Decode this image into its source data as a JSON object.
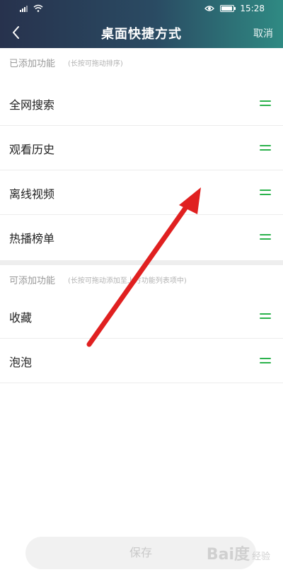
{
  "status_bar": {
    "time": "15:28",
    "signal_icon": "signal-icon",
    "wifi_icon": "wifi-icon",
    "eye_icon": "eye-comfort-icon",
    "battery_icon": "battery-icon"
  },
  "nav": {
    "back_icon": "back-chevron-icon",
    "title": "桌面快捷方式",
    "cancel": "取消"
  },
  "added": {
    "title": "已添加功能",
    "hint": "(长按可拖动排序)",
    "items": [
      {
        "label": "全网搜索"
      },
      {
        "label": "观看历史"
      },
      {
        "label": "离线视频"
      },
      {
        "label": "热播榜单"
      }
    ]
  },
  "available": {
    "title": "可添加功能",
    "hint": "(长按可拖动添加至上方功能列表项中)",
    "items": [
      {
        "label": "收藏"
      },
      {
        "label": "泡泡"
      }
    ]
  },
  "save_button": "保存",
  "watermark": {
    "brand": "Bai度",
    "sub": "经验"
  },
  "colors": {
    "header_start": "#27324d",
    "header_end": "#2f8a83",
    "drag_handle": "#2bb24c",
    "annotation_arrow": "#e02020"
  }
}
